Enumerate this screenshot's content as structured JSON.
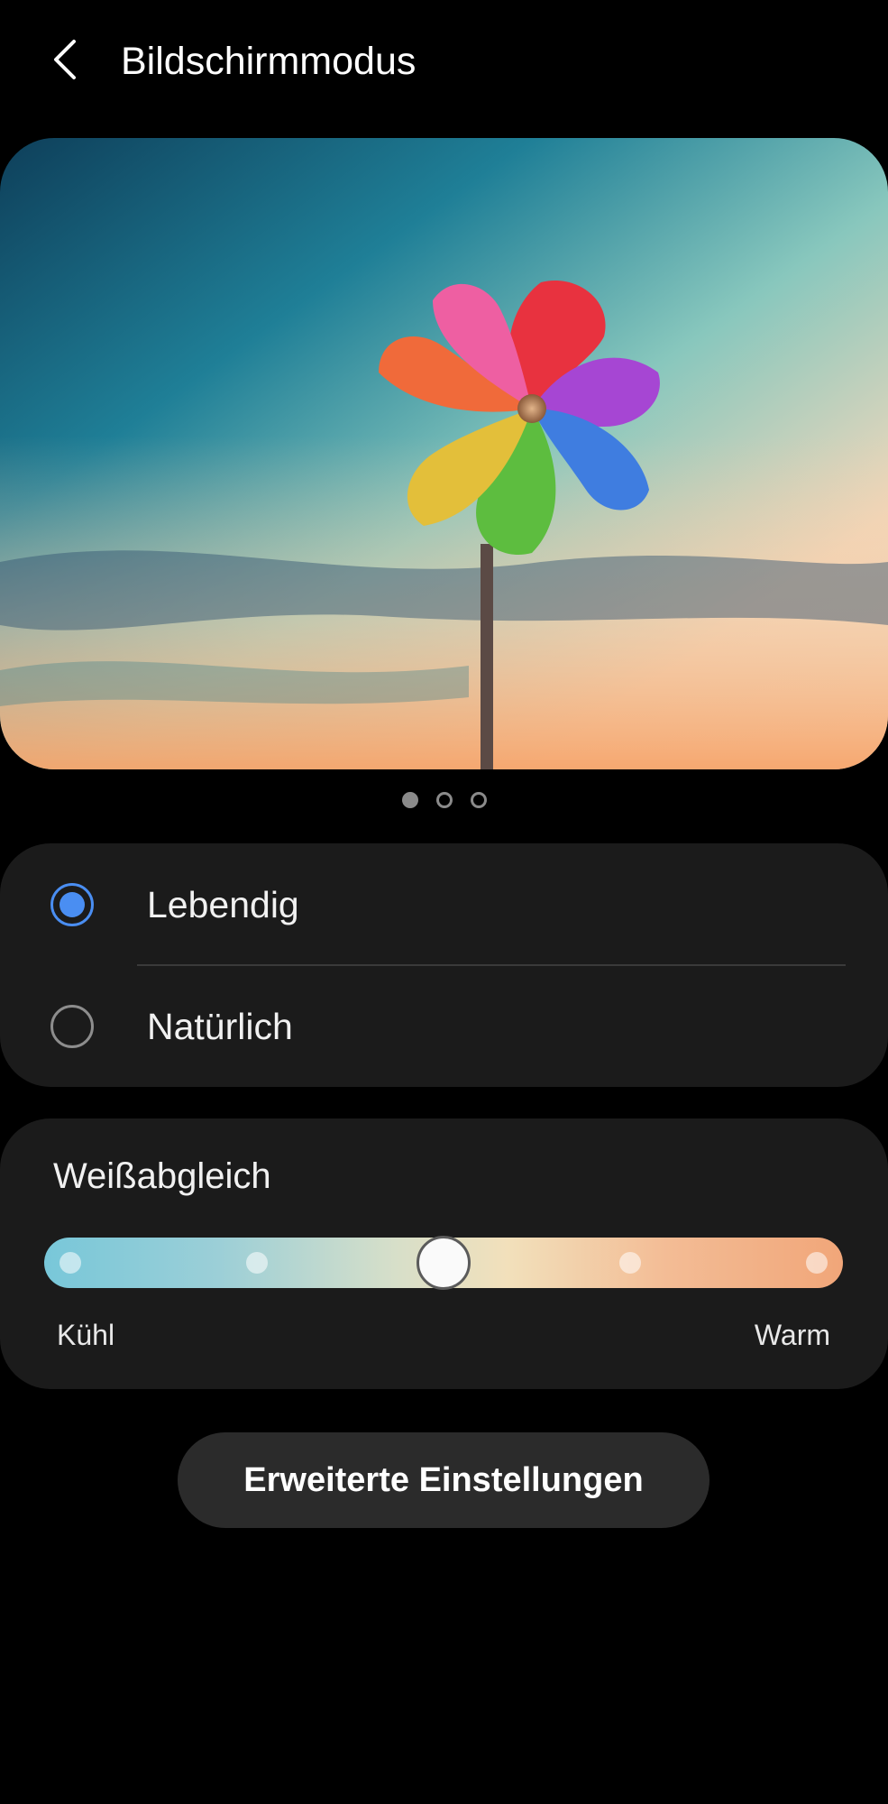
{
  "header": {
    "title": "Bildschirmmodus",
    "back_icon": "chevron-left-icon"
  },
  "preview": {
    "image": "colorful-pinwheel-sunset",
    "pages": 3,
    "active_page": 1
  },
  "modes": [
    {
      "label": "Lebendig",
      "selected": true
    },
    {
      "label": "Natürlich",
      "selected": false
    }
  ],
  "white_balance": {
    "title": "Weißabgleich",
    "left_label": "Kühl",
    "right_label": "Warm",
    "steps": 5,
    "value_index": 2,
    "colors": {
      "cool": "#78c7d9",
      "neutral": "#f2e0bb",
      "warm": "#f1a679"
    }
  },
  "advanced_button": {
    "label": "Erweiterte Einstellungen"
  },
  "colors": {
    "background": "#000000",
    "card": "#1b1b1b",
    "accent": "#4a8ef2",
    "button": "#2b2b2b"
  }
}
